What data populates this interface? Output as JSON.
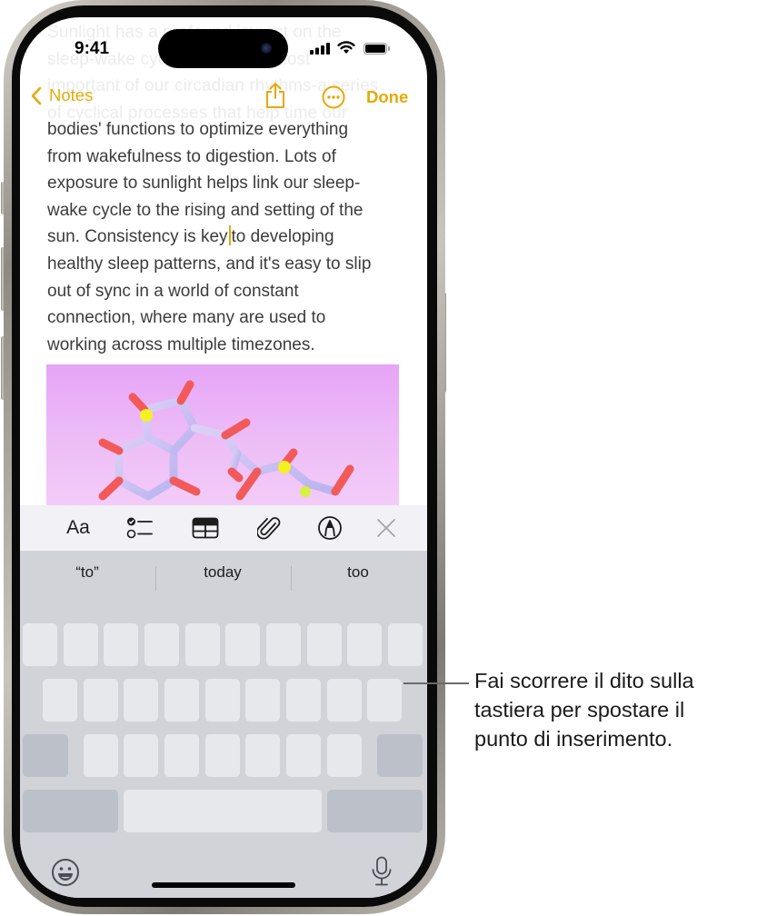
{
  "status_bar": {
    "time": "9:41"
  },
  "nav": {
    "back_label": "Notes",
    "done_label": "Done",
    "icons": [
      "chevron-left-icon",
      "share-icon",
      "more-ellipsis-icon"
    ],
    "accent_color": "#e5a908"
  },
  "note": {
    "faded_lines": [
      "Sunlight has a profound impact on the",
      "sleep-wake cycle, one of the most",
      "important of our circadian rhythms-a series",
      "of cyclical processes that help time our"
    ],
    "lines": [
      "bodies' functions to optimize everything",
      "from wakefulness to digestion. Lots of",
      "exposure to sunlight helps link our sleep-",
      "wake cycle to the rising and setting of the",
      {
        "before_caret": "sun. Consistency is key",
        "after_caret": "to developing"
      },
      "healthy sleep patterns, and it's easy to slip",
      "out of sync in a world of constant",
      "connection, where many are used to",
      "working across multiple timezones."
    ],
    "image_description": "molecule-illustration"
  },
  "format_toolbar": {
    "text_style_label": "Aa",
    "items": [
      "text-format-button",
      "checklist-button",
      "table-button",
      "attachment-button",
      "markup-button",
      "close-toolbar-button"
    ]
  },
  "keyboard": {
    "predictions": [
      "“to”",
      "today",
      "too"
    ],
    "rows_key_counts": [
      10,
      9,
      9,
      3
    ]
  },
  "callout": {
    "lines": [
      "Fai scorrere il dito sulla",
      "tastiera per spostare il",
      "punto di inserimento."
    ]
  }
}
